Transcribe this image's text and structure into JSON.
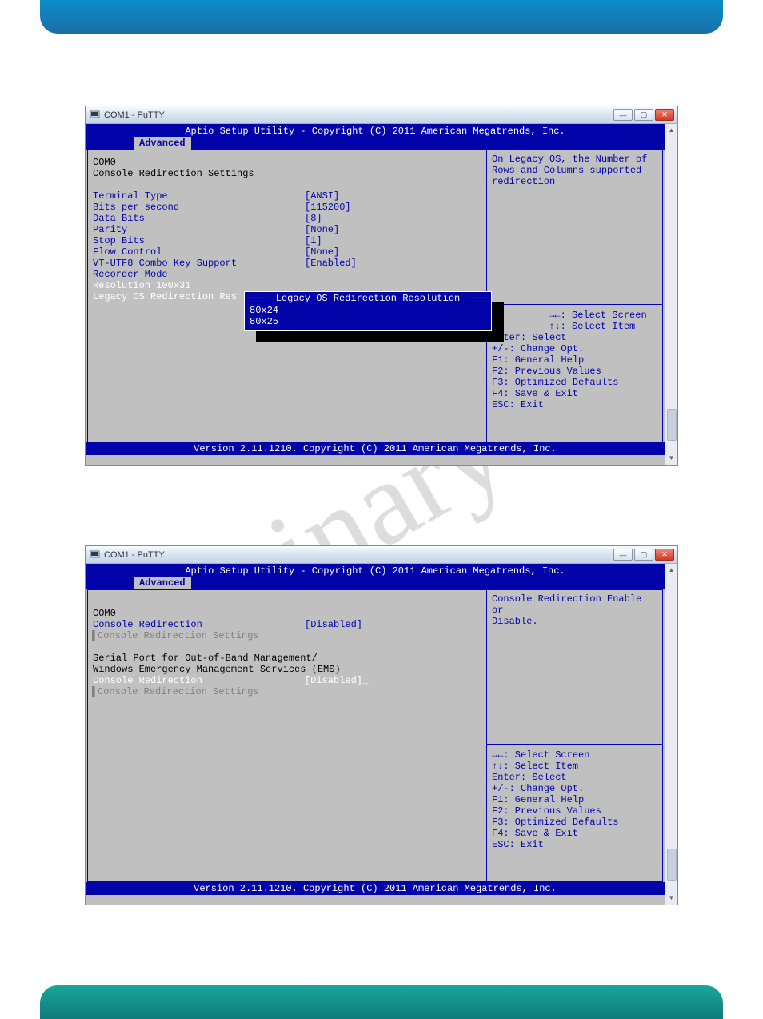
{
  "banner_top": "",
  "banner_bottom": "",
  "watermark": "inary",
  "window1": {
    "title": "COM1 - PuTTY",
    "bios_header": "Aptio Setup Utility - Copyright (C) 2011 American Megatrends, Inc.",
    "tab": "Advanced",
    "heading1": "COM0",
    "heading2": "Console Redirection Settings",
    "settings": [
      {
        "label": "Terminal Type",
        "value": "[ANSI]"
      },
      {
        "label": "Bits per second",
        "value": "[115200]"
      },
      {
        "label": "Data Bits",
        "value": "[8]"
      },
      {
        "label": "Parity",
        "value": "[None]"
      },
      {
        "label": "Stop Bits",
        "value": "[1]"
      },
      {
        "label": "Flow Control",
        "value": "[None]"
      },
      {
        "label": "VT-UTF8 Combo Key Support",
        "value": "[Enabled]"
      },
      {
        "label": "Recorder Mode",
        "value": ""
      },
      {
        "label": "Resolution 100x31",
        "value": ""
      },
      {
        "label": "Legacy OS Redirection Res",
        "value": ""
      }
    ],
    "popup_title": "Legacy OS Redirection Resolution",
    "popup_options": [
      "80x24",
      "80x25"
    ],
    "help_text": [
      "On Legacy OS, the Number of",
      "Rows and Columns supported",
      "redirection"
    ],
    "nav_help": [
      "→←: Select Screen",
      "↑↓: Select Item",
      "Enter: Select",
      "+/-: Change Opt.",
      "F1: General Help",
      "F2: Previous Values",
      "F3: Optimized Defaults",
      "F4: Save & Exit",
      "ESC: Exit"
    ],
    "bios_footer": "Version 2.11.1210. Copyright (C) 2011 American Megatrends, Inc."
  },
  "window2": {
    "title": "COM1 - PuTTY",
    "bios_header": "Aptio Setup Utility - Copyright (C) 2011 American Megatrends, Inc.",
    "tab": "Advanced",
    "heading1": "COM0",
    "row_cr1_label": "Console Redirection",
    "row_cr1_value": "[Disabled]",
    "row_crs1": "Console Redirection Settings",
    "section2_line1": "Serial Port for Out-of-Band Management/",
    "section2_line2": "Windows Emergency Management Services (EMS)",
    "row_cr2_label": "Console Redirection",
    "row_cr2_value": "[Disabled]",
    "row_crs2": "Console Redirection Settings",
    "help_text": [
      "Console Redirection Enable or",
      "Disable."
    ],
    "nav_help": [
      "→←: Select Screen",
      "↑↓: Select Item",
      "Enter: Select",
      "+/-: Change Opt.",
      "F1: General Help",
      "F2: Previous Values",
      "F3: Optimized Defaults",
      "F4: Save & Exit",
      "ESC: Exit"
    ],
    "bios_footer": "Version 2.11.1210. Copyright (C) 2011 American Megatrends, Inc."
  }
}
